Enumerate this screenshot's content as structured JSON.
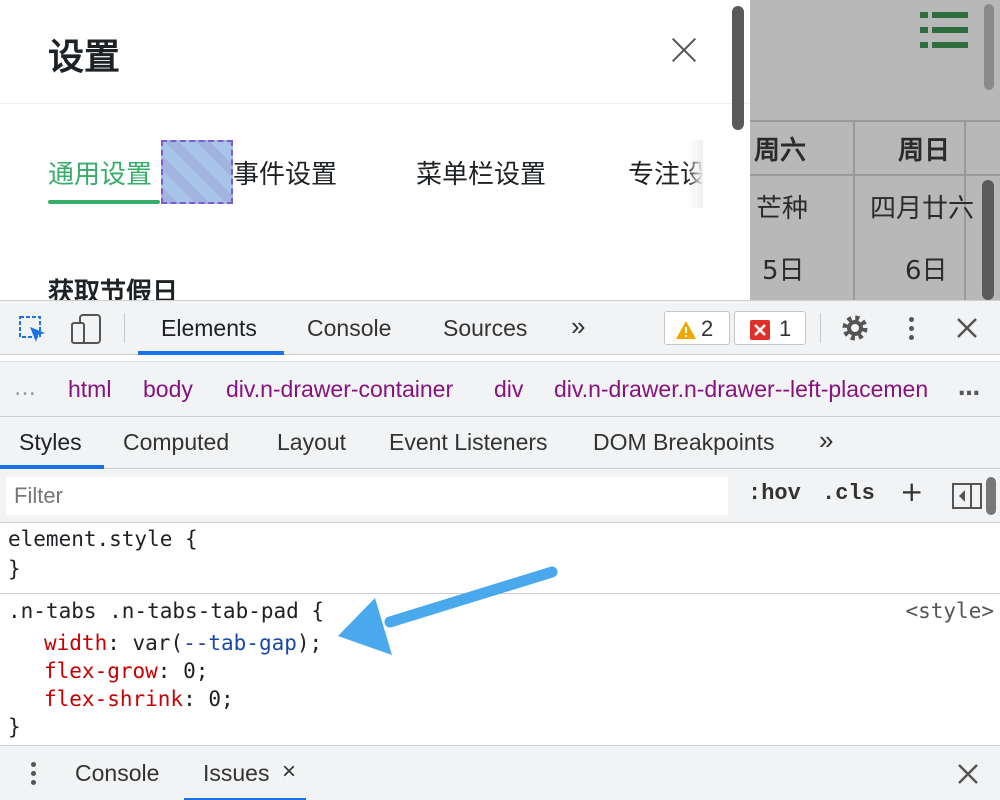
{
  "app": {
    "drawer_title": "设置",
    "tabs": [
      {
        "label": "通用设置",
        "active": true
      },
      {
        "label": "事件设置",
        "active": false
      },
      {
        "label": "菜单栏设置",
        "active": false
      },
      {
        "label": "专注设",
        "active": false
      }
    ],
    "section_title": "获取节假日",
    "accent_color": "#36ad6a"
  },
  "calendar": {
    "headers": [
      "周六",
      "周日"
    ],
    "row1": [
      "芒种",
      "四月廿六"
    ],
    "row2": [
      "5日",
      "6日"
    ]
  },
  "devtools": {
    "main_tabs": [
      "Elements",
      "Console",
      "Sources"
    ],
    "more_tabs": "»",
    "warning_count": "2",
    "error_count": "1",
    "breadcrumbs": [
      {
        "tag": "html",
        "cls": ""
      },
      {
        "tag": "body",
        "cls": ""
      },
      {
        "tag": "div",
        "cls": ".n-drawer-container"
      },
      {
        "tag": "div",
        "cls": ""
      },
      {
        "tag": "div",
        "cls": ".n-drawer.n-drawer--left-placemen"
      }
    ],
    "breadcrumb_more": "…",
    "sub_tabs": [
      "Styles",
      "Computed",
      "Layout",
      "Event Listeners",
      "DOM Breakpoints"
    ],
    "sub_more": "»",
    "filter_placeholder": "Filter",
    "hov_label": ":hov",
    "cls_label": ".cls",
    "plus_label": "+",
    "rules": {
      "element_style": {
        "selector": "element.style {",
        "close": "}"
      },
      "tab_pad": {
        "selector": ".n-tabs .n-tabs-tab-pad {",
        "source": "<style>",
        "width_prop": "width",
        "width_fn_open": "var(",
        "width_var": "--tab-gap",
        "width_fn_close": ");",
        "flex_grow_prop": "flex-grow",
        "flex_grow_val": "0;",
        "flex_shrink_prop": "flex-shrink",
        "flex_shrink_val": "0;",
        "close": "}"
      }
    },
    "drawer_tabs": [
      {
        "label": "Console",
        "active": false
      },
      {
        "label": "Issues",
        "active": true
      }
    ],
    "issues_close": "×",
    "accent_color": "#1a73e8",
    "annotation_arrow_color": "#4aa8ec"
  }
}
